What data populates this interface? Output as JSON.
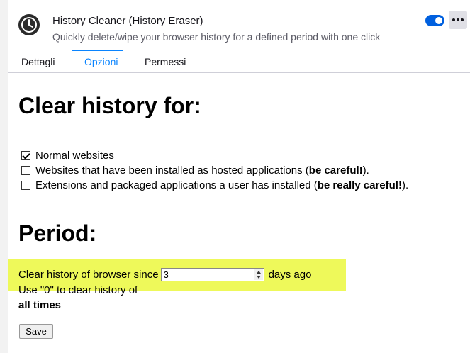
{
  "extension": {
    "title": "History Cleaner (History Eraser)",
    "description": "Quickly delete/wipe your browser history for a defined period with one click",
    "enabled": true,
    "icon": "clock-icon"
  },
  "tabs": [
    {
      "label": "Dettagli",
      "active": false
    },
    {
      "label": "Opzioni",
      "active": true
    },
    {
      "label": "Permessi",
      "active": false
    }
  ],
  "options": {
    "clear_heading": "Clear history for:",
    "checkboxes": [
      {
        "checked": true,
        "text": "Normal websites",
        "bold": "",
        "suffix": ""
      },
      {
        "checked": false,
        "text": "Websites that have been installed as hosted applications (",
        "bold": "be careful!",
        "suffix": ")."
      },
      {
        "checked": false,
        "text": "Extensions and packaged applications a user has installed (",
        "bold": "be really careful!",
        "suffix": ")."
      }
    ],
    "period_heading": "Period:",
    "since_label": "Clear history of browser since",
    "days_value": "3",
    "days_suffix": "days ago",
    "hint_line1": "Use \"0\" to clear history of",
    "hint_line2": "all times",
    "save_label": "Save"
  },
  "colors": {
    "accent": "#0a84ff",
    "highlight": "#eef95a",
    "toggle": "#0060df"
  }
}
